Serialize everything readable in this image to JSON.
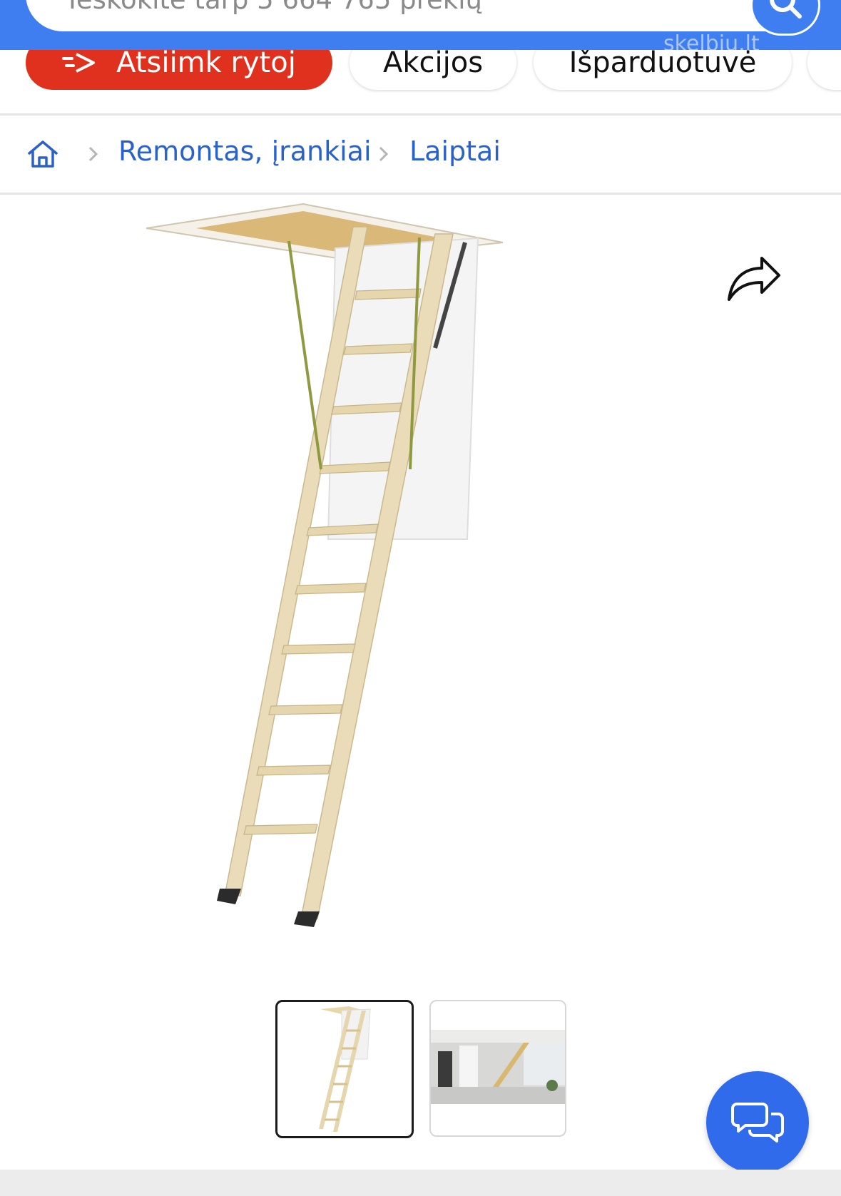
{
  "search": {
    "placeholder": "Ieškokite tarp 5 664 765 prekių",
    "watermark": "skelbiu.lt"
  },
  "chips": [
    {
      "label": "Atsiimk rytoj",
      "icon": "fast-delivery-icon"
    },
    {
      "label": "Akcijos"
    },
    {
      "label": "Išparduotuvė"
    }
  ],
  "breadcrumb": {
    "home_icon": "home-icon",
    "items": [
      "Remontas, įrankiai",
      "Laiptai"
    ]
  },
  "product": {
    "image_subject": "attic ladder",
    "thumbnails_count": 2,
    "selected_thumbnail": 1
  },
  "icons": {
    "share": "share-icon",
    "chat": "chat-bubbles-icon",
    "search": "search-icon"
  },
  "colors": {
    "brand_blue": "#3f7ef0",
    "link_blue": "#2a62c9",
    "primary_chip_red": "#e0301e",
    "chat_fab": "#2f6bea"
  }
}
